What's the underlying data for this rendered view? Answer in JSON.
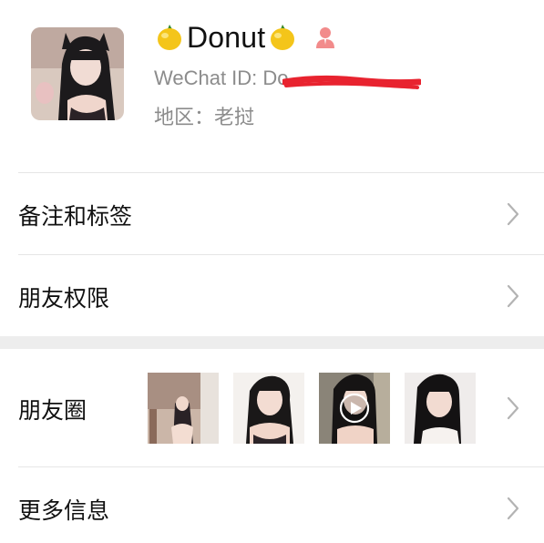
{
  "profile": {
    "name": "Donut",
    "wechat_id_label": "WeChat ID: Do",
    "region": "地区：老挝"
  },
  "rows": {
    "remarks_tags": "备注和标签",
    "friend_permissions": "朋友权限",
    "moments": "朋友圈",
    "more_info": "更多信息"
  },
  "colors": {
    "background": "#ffffff",
    "text": "#111111",
    "secondary_text": "#8c8c8c",
    "divider": "#e6e6e6",
    "section_gap": "#ededed",
    "redaction": "#e8232f",
    "person_icon": "#f28b8b"
  },
  "icons": {
    "lemon": "lemon-emoji-icon",
    "gender": "person-icon",
    "chevron": "chevron-right-icon",
    "play": "play-icon"
  }
}
